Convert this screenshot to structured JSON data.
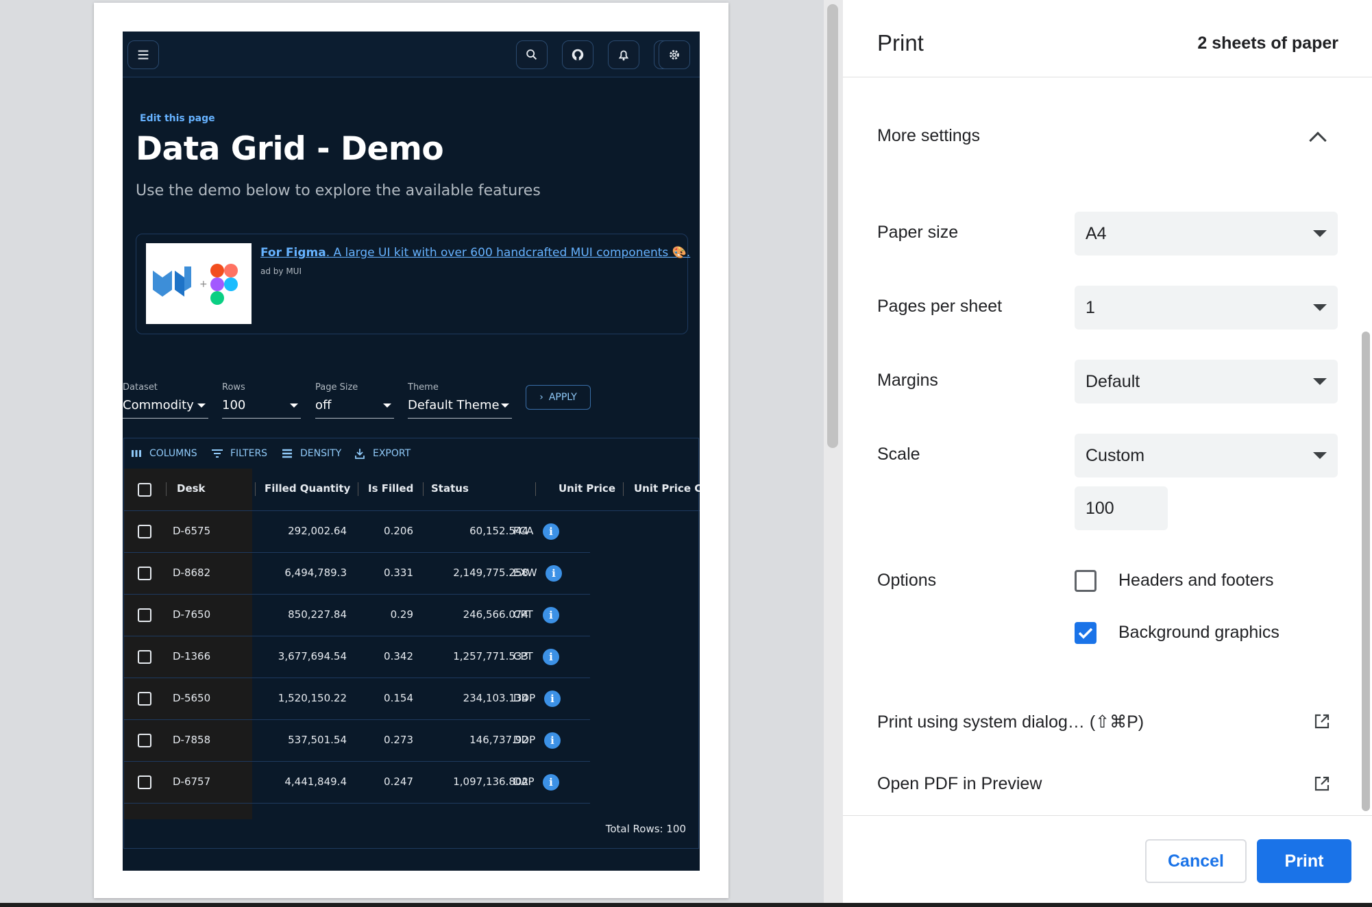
{
  "preview": {
    "edit_link": "Edit this page",
    "title": "Data Grid - Demo",
    "subtitle": "Use the demo below to explore the available features",
    "ad": {
      "title_bold": "For Figma",
      "title_rest": ". A large UI kit with over 600 handcrafted MUI components 🎨.",
      "by": "ad by MUI",
      "plus": "+"
    },
    "controls": {
      "dataset": {
        "label": "Dataset",
        "value": "Commodity"
      },
      "rows": {
        "label": "Rows",
        "value": "100"
      },
      "page_size": {
        "label": "Page Size",
        "value": "off"
      },
      "theme": {
        "label": "Theme",
        "value": "Default Theme"
      },
      "apply": "APPLY"
    },
    "toolbar": {
      "columns": "COLUMNS",
      "filters": "FILTERS",
      "density": "DENSITY",
      "export": "EXPORT"
    },
    "headers": [
      "Desk",
      "Filled Quantity",
      "Is Filled",
      "Status",
      "Unit Price",
      "Unit Price Cu"
    ],
    "rows": [
      {
        "desk": "D-6575",
        "filled_qty": "292,002.64",
        "is_filled": "0.206",
        "status": "60,152.544",
        "incoterm": "FCA"
      },
      {
        "desk": "D-8682",
        "filled_qty": "6,494,789.3",
        "is_filled": "0.331",
        "status": "2,149,775.258",
        "incoterm": "EXW"
      },
      {
        "desk": "D-7650",
        "filled_qty": "850,227.84",
        "is_filled": "0.29",
        "status": "246,566.074",
        "incoterm": "CPT"
      },
      {
        "desk": "D-1366",
        "filled_qty": "3,677,694.54",
        "is_filled": "0.342",
        "status": "1,257,771.533",
        "incoterm": "CPT"
      },
      {
        "desk": "D-5650",
        "filled_qty": "1,520,150.22",
        "is_filled": "0.154",
        "status": "234,103.134",
        "incoterm": "DDP"
      },
      {
        "desk": "D-7858",
        "filled_qty": "537,501.54",
        "is_filled": "0.273",
        "status": "146,737.92",
        "incoterm": "DDP"
      },
      {
        "desk": "D-6757",
        "filled_qty": "4,441,849.4",
        "is_filled": "0.247",
        "status": "1,097,136.802",
        "incoterm": "DAP"
      }
    ],
    "info_glyph": "i",
    "footer": "Total Rows: 100"
  },
  "print": {
    "title": "Print",
    "sheets": "2 sheets of paper",
    "more_settings": "More settings",
    "paper_size": {
      "label": "Paper size",
      "value": "A4"
    },
    "pages_per_sheet": {
      "label": "Pages per sheet",
      "value": "1"
    },
    "margins": {
      "label": "Margins",
      "value": "Default"
    },
    "scale": {
      "label": "Scale",
      "value": "Custom",
      "custom_value": "100"
    },
    "options": {
      "label": "Options",
      "headers_footers": {
        "label": "Headers and footers",
        "checked": false
      },
      "background_graphics": {
        "label": "Background graphics",
        "checked": true
      }
    },
    "system_dialog": "Print using system dialog… (⇧⌘P)",
    "open_pdf": "Open PDF in Preview",
    "cancel": "Cancel",
    "print_button": "Print"
  },
  "colors": {
    "accent": "#1a73e8",
    "mui_bg": "#0a1929",
    "mui_link": "#66b2ff"
  }
}
